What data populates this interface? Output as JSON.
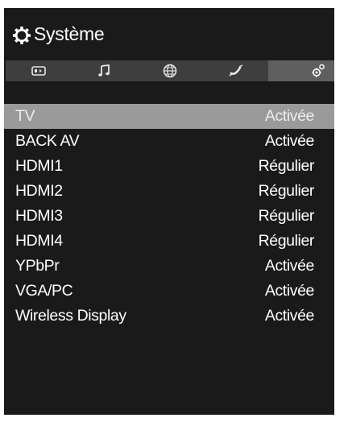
{
  "header": {
    "title": "Système",
    "icon": "gear-icon"
  },
  "tabs": [
    {
      "icon": "picture-icon",
      "active": false
    },
    {
      "icon": "music-note-icon",
      "active": false
    },
    {
      "icon": "globe-icon",
      "active": false
    },
    {
      "icon": "satellite-icon",
      "active": false
    },
    {
      "icon": "settings-cogs-icon",
      "active": true
    }
  ],
  "menu": {
    "items": [
      {
        "label": "TV",
        "value": "Activée",
        "selected": true
      },
      {
        "label": "BACK AV",
        "value": "Activée",
        "selected": false
      },
      {
        "label": "HDMI1",
        "value": "Régulier",
        "selected": false
      },
      {
        "label": "HDMI2",
        "value": "Régulier",
        "selected": false
      },
      {
        "label": "HDMI3",
        "value": "Régulier",
        "selected": false
      },
      {
        "label": "HDMI4",
        "value": "Régulier",
        "selected": false
      },
      {
        "label": "YPbPr",
        "value": "Activée",
        "selected": false
      },
      {
        "label": "VGA/PC",
        "value": "Activée",
        "selected": false
      },
      {
        "label": "Wireless Display",
        "value": "Activée",
        "selected": false
      }
    ]
  },
  "colors": {
    "panel_bg": "#1a1a1a",
    "tab_bar_bg": "#3e3e3e",
    "tab_active_bg": "#5f5f5f",
    "row_selected_bg": "#9a9a9a",
    "text": "#ffffff"
  }
}
